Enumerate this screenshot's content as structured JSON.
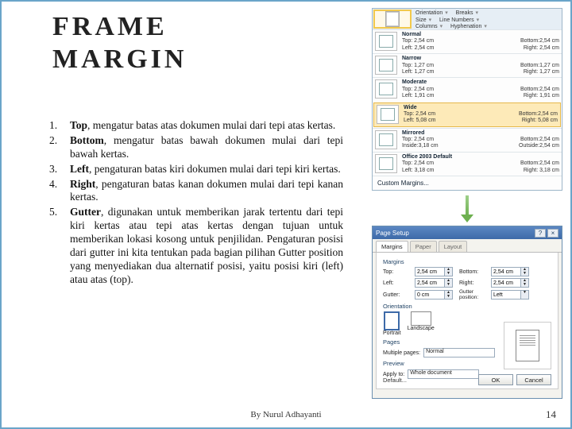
{
  "title_line1": "FRAME",
  "title_line2": "MARGIN",
  "items": [
    {
      "num": "1.",
      "term": "Top",
      "rest": ", mengatur batas atas dokumen mulai dari tepi atas kertas."
    },
    {
      "num": "2.",
      "term": "Bottom",
      "rest": ", mengatur batas bawah dokumen mulai dari tepi bawah kertas."
    },
    {
      "num": "3.",
      "term": "Left",
      "rest": ", pengaturan batas kiri dokumen mulai dari tepi kiri kertas."
    },
    {
      "num": "4.",
      "term": "Right",
      "rest": ", pengaturan batas kanan dokumen mulai dari tepi kanan kertas."
    },
    {
      "num": "5.",
      "term": "Gutter",
      "rest": ", digunakan untuk memberikan jarak tertentu dari tepi kiri kertas atau tepi atas kertas dengan tujuan untuk memberikan lokasi kosong untuk penjilidan. Pengaturan posisi dari gutter ini kita tentukan pada bagian pilihan Gutter position yang menyediakan dua alternatif posisi, yaitu posisi kiri (left) atau atas (top)."
    }
  ],
  "footer": "By Nurul Adhayanti",
  "page_number": "14",
  "ribbon": {
    "orientation": "Orientation",
    "breaks": "Breaks",
    "size": "Size",
    "line_numbers": "Line Numbers",
    "columns": "Columns",
    "hyphenation": "Hyphenation",
    "margins_label": "Margins"
  },
  "presets": [
    {
      "name": "Normal",
      "l1": "Top: 2,54 cm",
      "l2": "Left: 2,54 cm",
      "r1": "Bottom:2,54 cm",
      "r2": "Right: 2,54 cm"
    },
    {
      "name": "Narrow",
      "l1": "Top: 1,27 cm",
      "l2": "Left: 1,27 cm",
      "r1": "Bottom:1,27 cm",
      "r2": "Right: 1,27 cm"
    },
    {
      "name": "Moderate",
      "l1": "Top: 2,54 cm",
      "l2": "Left: 1,91 cm",
      "r1": "Bottom:2,54 cm",
      "r2": "Right: 1,91 cm"
    },
    {
      "name": "Wide",
      "l1": "Top: 2,54 cm",
      "l2": "Left: 5,08 cm",
      "r1": "Bottom:2,54 cm",
      "r2": "Right: 5,08 cm"
    },
    {
      "name": "Mirrored",
      "l1": "Top: 2,54 cm",
      "l2": "Inside:3,18 cm",
      "r1": "Bottom:2,54 cm",
      "r2": "Outside:2,54 cm"
    },
    {
      "name": "Office 2003 Default",
      "l1": "Top: 2,54 cm",
      "l2": "Left: 3,18 cm",
      "r1": "Bottom:2,54 cm",
      "r2": "Right: 3,18 cm"
    }
  ],
  "custom_margins_label": "Custom Margins...",
  "dialog": {
    "title": "Page Setup",
    "tabs": {
      "margins": "Margins",
      "paper": "Paper",
      "layout": "Layout"
    },
    "section_margins": "Margins",
    "fields": {
      "top_label": "Top:",
      "top_val": "2,54 cm",
      "bottom_label": "Bottom:",
      "bottom_val": "2,54 cm",
      "left_label": "Left:",
      "left_val": "2,54 cm",
      "right_label": "Right:",
      "right_val": "2,54 cm",
      "gutter_label": "Gutter:",
      "gutter_val": "0 cm",
      "gutter_pos_label": "Gutter position:",
      "gutter_pos_val": "Left"
    },
    "section_orientation": "Orientation",
    "orientation": {
      "portrait": "Portrait",
      "landscape": "Landscape"
    },
    "section_pages": "Pages",
    "multiple_pages_label": "Multiple pages:",
    "multiple_pages_val": "Normal",
    "section_preview": "Preview",
    "apply_to_label": "Apply to:",
    "apply_to_val": "Whole document",
    "default_btn": "Default...",
    "ok": "OK",
    "cancel": "Cancel"
  }
}
